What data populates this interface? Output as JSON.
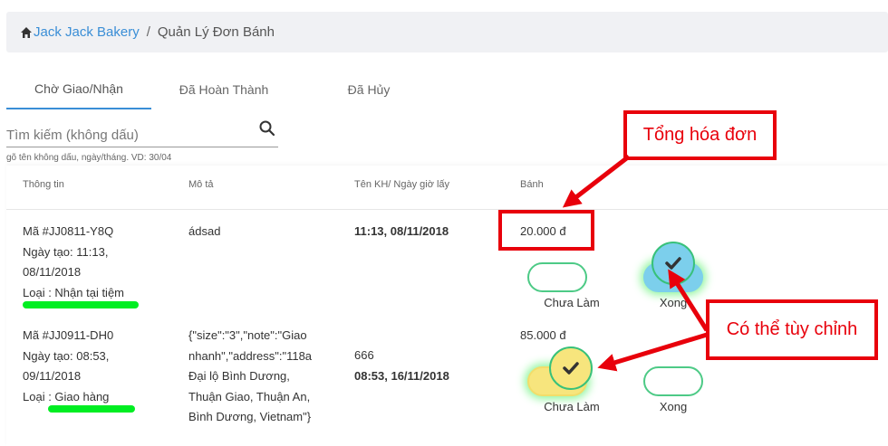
{
  "breadcrumb": {
    "home": "Jack Jack Bakery",
    "separator": "/",
    "current": "Quản Lý Đơn Bánh"
  },
  "tabs": [
    {
      "label": "Chờ Giao/Nhận",
      "active": true
    },
    {
      "label": "Đã Hoàn Thành",
      "active": false
    },
    {
      "label": "Đã Hủy",
      "active": false
    }
  ],
  "search": {
    "placeholder": "Tìm kiếm (không dấu)",
    "value": "",
    "hint": "gõ tên không dấu, ngày/tháng. VD: 30/04"
  },
  "table": {
    "headers": [
      "Thông tin",
      "Mô tả",
      "Tên KH/ Ngày giờ lấy",
      "Bánh"
    ],
    "rows": [
      {
        "info": [
          "Mã #JJ0811-Y8Q",
          "Ngày tạo: 11:13,",
          "08/11/2018",
          "Loại : Nhận tại tiệm"
        ],
        "description": [
          "ádsad"
        ],
        "customer": "",
        "pickup": "11:13, 08/11/2018",
        "amount": "20.000 đ",
        "status_wip_label": "Chưa Làm",
        "status_done_label": "Xong",
        "selected": "done"
      },
      {
        "info": [
          "Mã #JJ0911-DH0",
          "Ngày tạo: 08:53,",
          "09/11/2018",
          "Loại : Giao hàng"
        ],
        "description": [
          "{\"size\":\"3\",\"note\":\"Giao",
          "nhanh\",\"address\":\"118a",
          "Đại lộ Bình Dương,",
          "Thuận Giao, Thuận An,",
          "Bình Dương, Vietnam\"}"
        ],
        "customer": "666",
        "pickup": "08:53, 16/11/2018",
        "amount": "85.000 đ",
        "status_wip_label": "Chưa Làm",
        "status_done_label": "Xong",
        "selected": "wip"
      }
    ]
  },
  "annotations": {
    "total_label": "Tổng hóa đơn",
    "customize_label": "Có thể tùy chỉnh"
  },
  "colors": {
    "accent": "#3a8ed6",
    "callout": "#e8000b",
    "highlight": "#00ee22",
    "toggle_border": "#4dca86",
    "done_fill": "#7ccfec",
    "wip_fill": "#f7e57d"
  }
}
